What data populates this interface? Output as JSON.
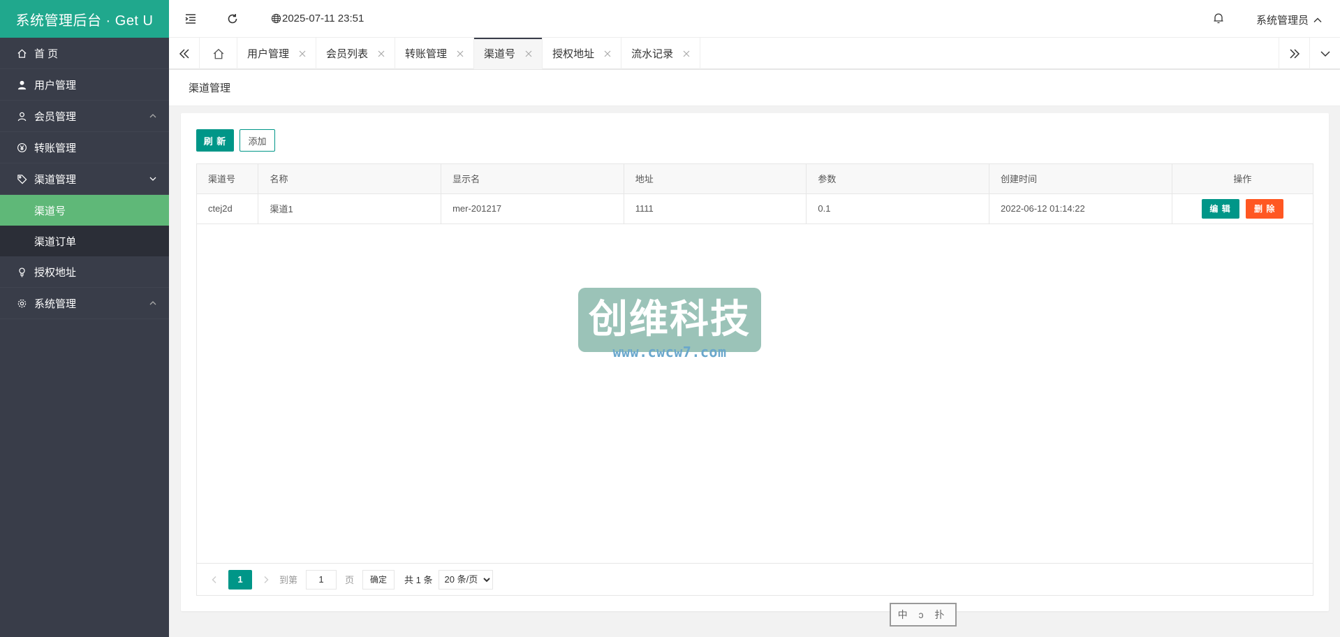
{
  "brand": {
    "title": "系统管理后台 · Get U"
  },
  "sidebar": {
    "items": [
      {
        "label": "首 页",
        "icon": "home-icon"
      },
      {
        "label": "用户管理",
        "icon": "user-icon"
      },
      {
        "label": "会员管理",
        "icon": "member-icon",
        "expandable": true
      },
      {
        "label": "转账管理",
        "icon": "yen-icon"
      },
      {
        "label": "渠道管理",
        "icon": "tag-icon",
        "expanded": true
      },
      {
        "label": "授权地址",
        "icon": "bulb-icon"
      },
      {
        "label": "系统管理",
        "icon": "gear-icon",
        "expandable": true
      }
    ],
    "sub_items": [
      {
        "label": "渠道号",
        "active": true
      },
      {
        "label": "渠道订单",
        "active": false
      }
    ]
  },
  "header": {
    "datetime": "2025-07-11 23:51",
    "user": "系统管理员"
  },
  "tabs": [
    {
      "label": "用户管理"
    },
    {
      "label": "会员列表"
    },
    {
      "label": "转账管理"
    },
    {
      "label": "渠道号",
      "active": true
    },
    {
      "label": "授权地址"
    },
    {
      "label": "流水记录"
    }
  ],
  "breadcrumb": "渠道管理",
  "toolbar": {
    "refresh_label": "刷 新",
    "add_label": "添加"
  },
  "table": {
    "columns": [
      "渠道号",
      "名称",
      "显示名",
      "地址",
      "参数",
      "创建时间",
      "操作"
    ],
    "rows": [
      {
        "code": "ctej2d",
        "name": "渠道1",
        "display": "mer-201217",
        "address": "1111",
        "param": "0.1",
        "created": "2022-06-12 01:14:22",
        "edit": "编 辑",
        "delete": "删 除"
      }
    ]
  },
  "pager": {
    "current": "1",
    "goto_label": "到第",
    "goto_value": "1",
    "page_unit": "页",
    "confirm": "确定",
    "total": "共 1 条",
    "page_size": "20 条/页"
  },
  "watermark": {
    "text": "创维科技",
    "url": "www.cwcw7.com"
  },
  "stamp": {
    "text": "中 ɔ 扑"
  },
  "colors": {
    "brand": "#20a88d",
    "sidebar": "#393d49",
    "primary": "#009688",
    "danger": "#ff5722",
    "active_sub": "#5fb878"
  }
}
